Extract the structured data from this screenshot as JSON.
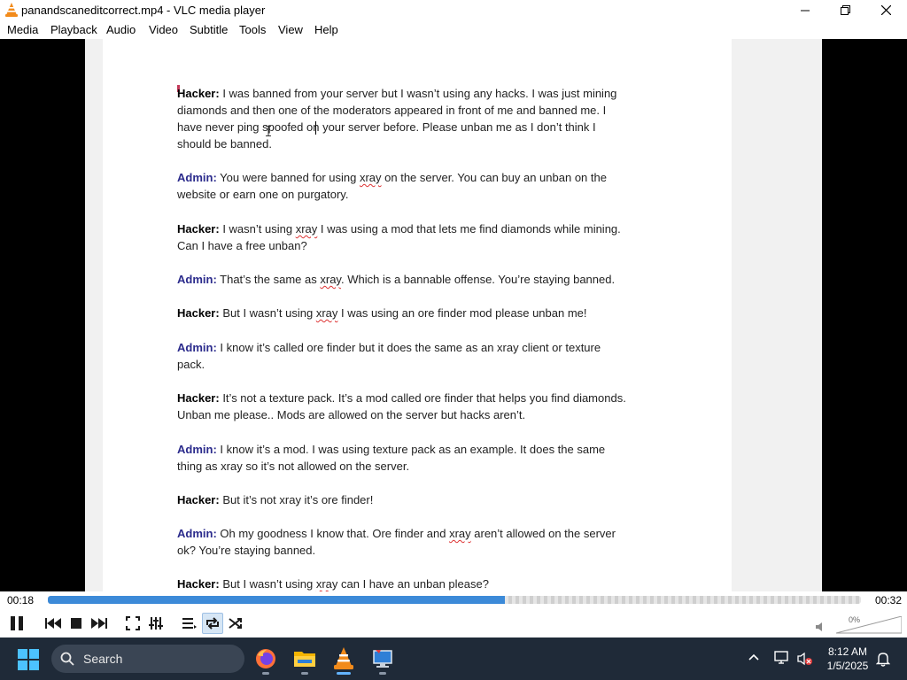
{
  "window": {
    "title": "panandscaneditcorrect.mp4 - VLC media player"
  },
  "menu": [
    "Media",
    "Playback",
    "Audio",
    "Video",
    "Subtitle",
    "Tools",
    "View",
    "Help"
  ],
  "document": {
    "paragraphs": [
      {
        "speaker": "Hacker:",
        "role": "hacker",
        "lines": [
          [
            {
              "t": " I was banned from your server but I wasn’t using any hacks. I was just mining"
            }
          ],
          [
            {
              "t": "diamonds and then one of the moderators appeared in front of me and banned me. I"
            }
          ],
          [
            {
              "t": "have never ping spoofed on your server before. Please unban me as I don’t think I"
            }
          ],
          [
            {
              "t": "should be banned."
            }
          ]
        ]
      },
      {
        "speaker": "Admin:",
        "role": "admin",
        "lines": [
          [
            {
              "t": " You were banned for using "
            },
            {
              "t": "xray",
              "sq": true
            },
            {
              "t": " on the server. You can buy an unban on the"
            }
          ],
          [
            {
              "t": "website or earn one on purgatory."
            }
          ]
        ]
      },
      {
        "speaker": "Hacker:",
        "role": "hacker",
        "lines": [
          [
            {
              "t": " I wasn’t using "
            },
            {
              "t": "xray",
              "sq": true
            },
            {
              "t": " I was using a mod that lets me find diamonds while mining."
            }
          ],
          [
            {
              "t": "Can I have a free unban?"
            }
          ]
        ]
      },
      {
        "speaker": "Admin:",
        "role": "admin",
        "lines": [
          [
            {
              "t": " That’s the same as "
            },
            {
              "t": "xray",
              "sq": true
            },
            {
              "t": ". Which is a bannable offense. You’re staying banned."
            }
          ]
        ]
      },
      {
        "speaker": "Hacker:",
        "role": "hacker",
        "lines": [
          [
            {
              "t": " But I wasn’t using "
            },
            {
              "t": "xray",
              "sq": true
            },
            {
              "t": " I was using an ore finder mod please unban me!"
            }
          ]
        ]
      },
      {
        "speaker": "Admin:",
        "role": "admin",
        "lines": [
          [
            {
              "t": " I know it’s called ore finder but it does the same as an xray client or texture"
            }
          ],
          [
            {
              "t": "pack."
            }
          ]
        ]
      },
      {
        "speaker": "Hacker:",
        "role": "hacker",
        "lines": [
          [
            {
              "t": " It’s not a texture pack. It’s a mod called ore finder that helps you find diamonds."
            }
          ],
          [
            {
              "t": "Unban me please.. Mods are allowed on the server but hacks aren’t."
            }
          ]
        ]
      },
      {
        "speaker": "Admin:",
        "role": "admin",
        "lines": [
          [
            {
              "t": " I know it’s a mod. I was using texture pack as an example. It does the same"
            }
          ],
          [
            {
              "t": "thing as xray so it’s not allowed on the server."
            }
          ]
        ]
      },
      {
        "speaker": "Hacker:",
        "role": "hacker",
        "lines": [
          [
            {
              "t": " But it’s not xray it’s ore finder!"
            }
          ]
        ]
      },
      {
        "speaker": "Admin:",
        "role": "admin",
        "lines": [
          [
            {
              "t": " Oh my goodness I know that. Ore finder and "
            },
            {
              "t": "xray",
              "sq": true
            },
            {
              "t": " aren’t allowed on the server"
            }
          ],
          [
            {
              "t": "ok? You’re staying banned."
            }
          ]
        ]
      },
      {
        "speaker": "Hacker:",
        "role": "hacker",
        "lines": [
          [
            {
              "t": " But I wasn’t using "
            },
            {
              "t": "xray",
              "sq": true
            },
            {
              "t": " can I have an unban please?"
            }
          ]
        ]
      }
    ]
  },
  "playback": {
    "elapsed": "00:18",
    "total": "00:32",
    "progress": 0.5625
  },
  "controls": {
    "buttons": [
      "pause",
      "previous",
      "stop",
      "next",
      "fullscreen",
      "extended-settings",
      "playlist",
      "loop",
      "shuffle"
    ],
    "loop_active": true,
    "volume_label": "0%",
    "volume": 0
  },
  "taskbar": {
    "search_placeholder": "Search",
    "apps": [
      "firefox",
      "file-explorer",
      "vlc",
      "remote-app"
    ],
    "active_app": "vlc",
    "time": "8:12 AM",
    "date": "1/5/2025"
  },
  "colors": {
    "seek_fill": "#3c8ad8",
    "admin_speaker": "#2b2b8c",
    "taskbar_bg": "#1f2a38",
    "vlc_orange": "#f28b1b"
  }
}
